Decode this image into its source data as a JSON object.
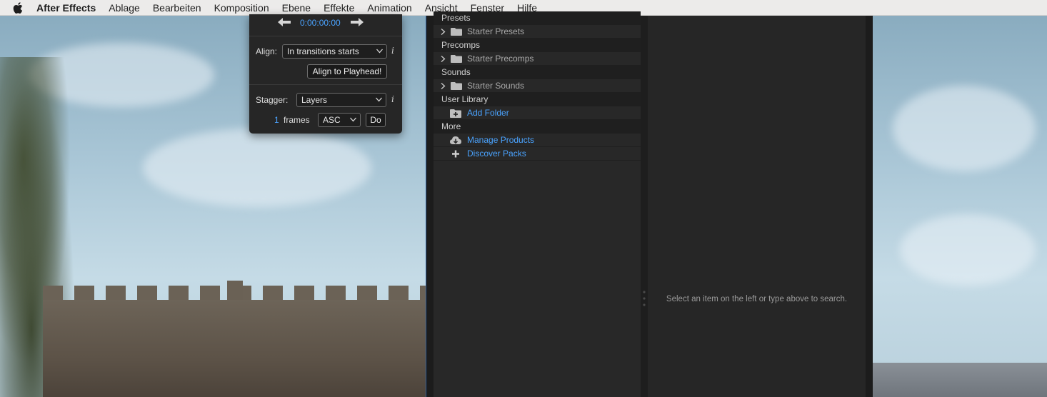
{
  "menubar": {
    "apple_icon": "apple-logo-icon",
    "app_name": "After Effects",
    "items": [
      "Ablage",
      "Bearbeiten",
      "Komposition",
      "Ebene",
      "Effekte",
      "Animation",
      "Ansicht",
      "Fenster",
      "Hilfe"
    ]
  },
  "align_panel": {
    "timecode": "0:00:00:00",
    "align_label": "Align:",
    "align_value": "In transitions starts",
    "align_button": "Align to Playhead!",
    "stagger_label": "Stagger:",
    "stagger_value": "Layers",
    "frames_count": "1",
    "frames_label": "frames",
    "order_value": "ASC",
    "do_button": "Do",
    "info_glyph": "i"
  },
  "library": {
    "sections": {
      "presets": "Presets",
      "precomps": "Precomps",
      "sounds": "Sounds",
      "user_library": "User Library",
      "more": "More"
    },
    "items": {
      "starter_presets": "Starter Presets",
      "starter_precomps": "Starter Precomps",
      "starter_sounds": "Starter Sounds",
      "add_folder": "Add Folder",
      "manage_products": "Manage Products",
      "discover_packs": "Discover Packs"
    },
    "detail_hint": "Select an item on the left or type above to search."
  },
  "colors": {
    "accent_blue": "#4aa3ff",
    "panel_bg": "#262626",
    "menubar_bg": "#ecebea"
  }
}
